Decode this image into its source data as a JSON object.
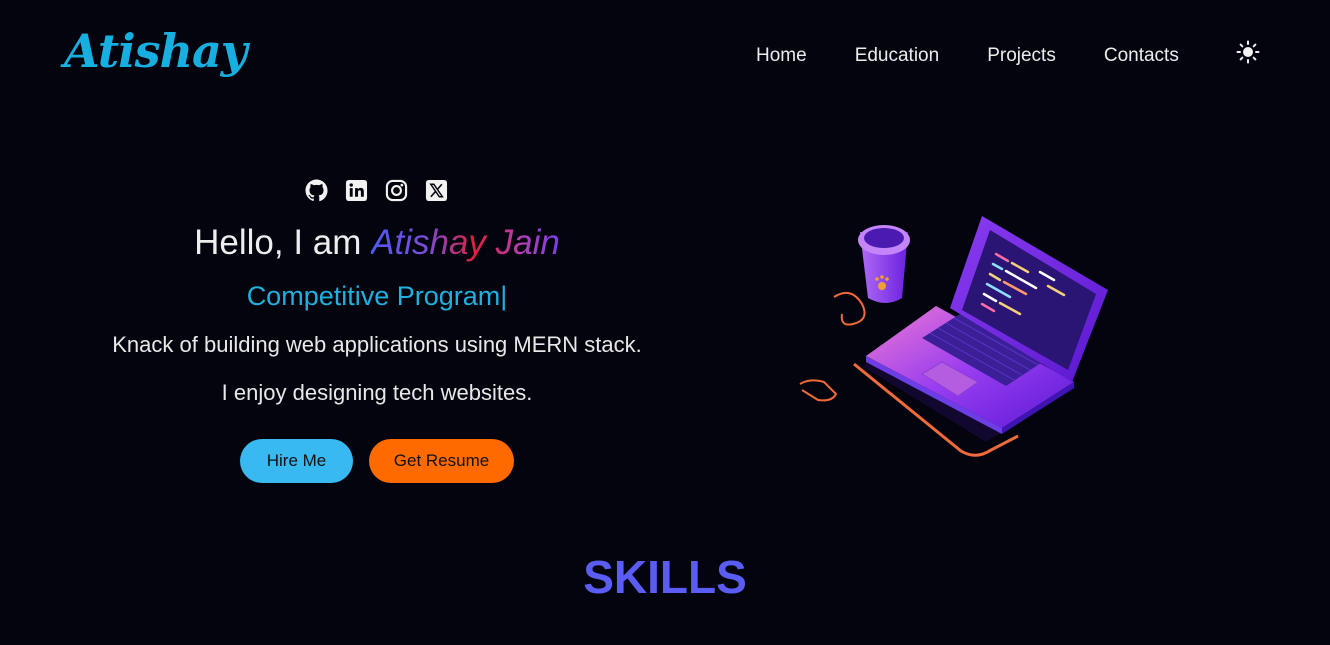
{
  "header": {
    "logo": "Atishay",
    "nav": [
      {
        "label": "Home"
      },
      {
        "label": "Education"
      },
      {
        "label": "Projects"
      },
      {
        "label": "Contacts"
      }
    ],
    "theme_icon": "sun-icon"
  },
  "hero": {
    "socials": [
      "github-icon",
      "linkedin-icon",
      "instagram-icon",
      "x-twitter-icon"
    ],
    "greeting": "Hello, I am",
    "name": "Atishay Jain",
    "typed_text": "Competitive Program|",
    "description_1": "Knack of building web applications using MERN stack.",
    "description_2": "I enjoy designing tech websites.",
    "hire_button": "Hire Me",
    "resume_button": "Get Resume",
    "illustration_icon": "laptop-coffee-illustration"
  },
  "skills": {
    "title": "SKILLS"
  },
  "colors": {
    "background": "#03040e",
    "logo": "#17aee0",
    "typed_text": "#1fb0dd",
    "hire_button": "#38b9f0",
    "resume_button": "#ff6a00",
    "skills_title": "#5a5cf4"
  }
}
